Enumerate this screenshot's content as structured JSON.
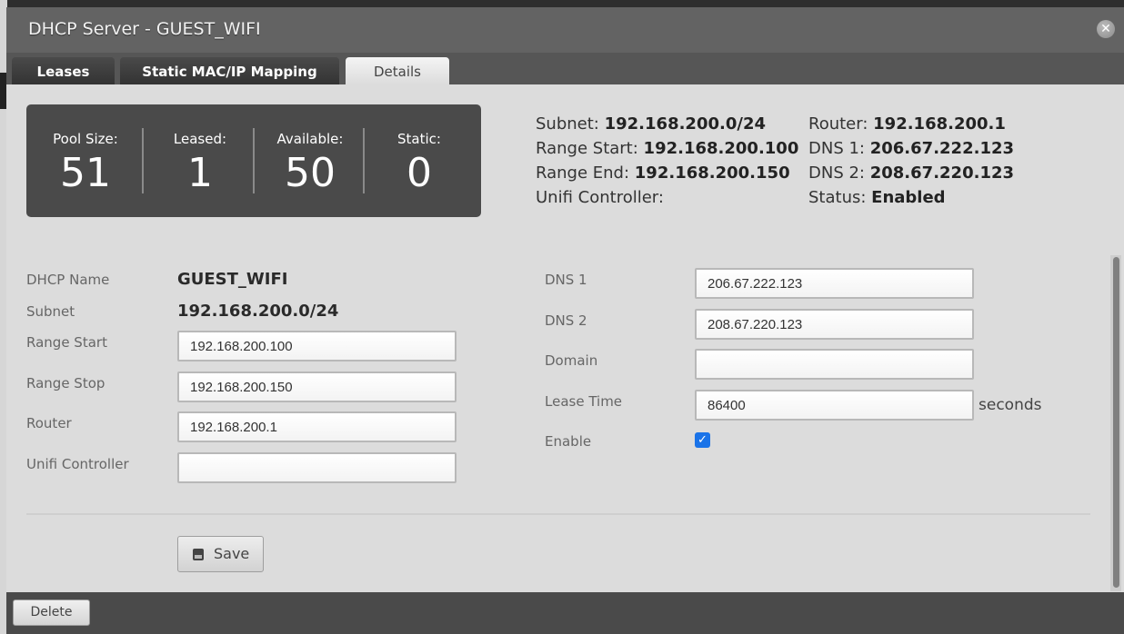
{
  "dialog": {
    "title": "DHCP Server - GUEST_WIFI",
    "close_icon": "close-icon"
  },
  "tabs": [
    {
      "label": "Leases",
      "active": false
    },
    {
      "label": "Static MAC/IP Mapping",
      "active": false
    },
    {
      "label": "Details",
      "active": true
    }
  ],
  "stats": [
    {
      "label": "Pool Size:",
      "value": "51"
    },
    {
      "label": "Leased:",
      "value": "1"
    },
    {
      "label": "Available:",
      "value": "50"
    },
    {
      "label": "Static:",
      "value": "0"
    }
  ],
  "summary": {
    "left": [
      {
        "label": "Subnet:",
        "value": "192.168.200.0/24"
      },
      {
        "label": "Range Start:",
        "value": "192.168.200.100"
      },
      {
        "label": "Range End:",
        "value": "192.168.200.150"
      },
      {
        "label": "Unifi Controller:",
        "value": ""
      }
    ],
    "right": [
      {
        "label": "Router:",
        "value": "192.168.200.1"
      },
      {
        "label": "DNS 1:",
        "value": "206.67.222.123"
      },
      {
        "label": "DNS 2:",
        "value": "208.67.220.123"
      },
      {
        "label": "Status:",
        "value": "Enabled"
      }
    ]
  },
  "form": {
    "dhcp_name": {
      "label": "DHCP Name",
      "value": "GUEST_WIFI"
    },
    "subnet": {
      "label": "Subnet",
      "value": "192.168.200.0/24"
    },
    "range_start": {
      "label": "Range Start",
      "value": "192.168.200.100"
    },
    "range_stop": {
      "label": "Range Stop",
      "value": "192.168.200.150"
    },
    "router": {
      "label": "Router",
      "value": "192.168.200.1"
    },
    "unifi_controller": {
      "label": "Unifi Controller",
      "value": ""
    },
    "dns1": {
      "label": "DNS 1",
      "value": "206.67.222.123"
    },
    "dns2": {
      "label": "DNS 2",
      "value": "208.67.220.123"
    },
    "domain": {
      "label": "Domain",
      "value": ""
    },
    "lease_time": {
      "label": "Lease Time",
      "value": "86400",
      "suffix": "seconds"
    },
    "enable": {
      "label": "Enable",
      "checked": true
    }
  },
  "buttons": {
    "save": "Save",
    "delete": "Delete"
  },
  "colors": {
    "checkbox_accent": "#1a73e8",
    "stats_bg": "#4a4a4a"
  }
}
